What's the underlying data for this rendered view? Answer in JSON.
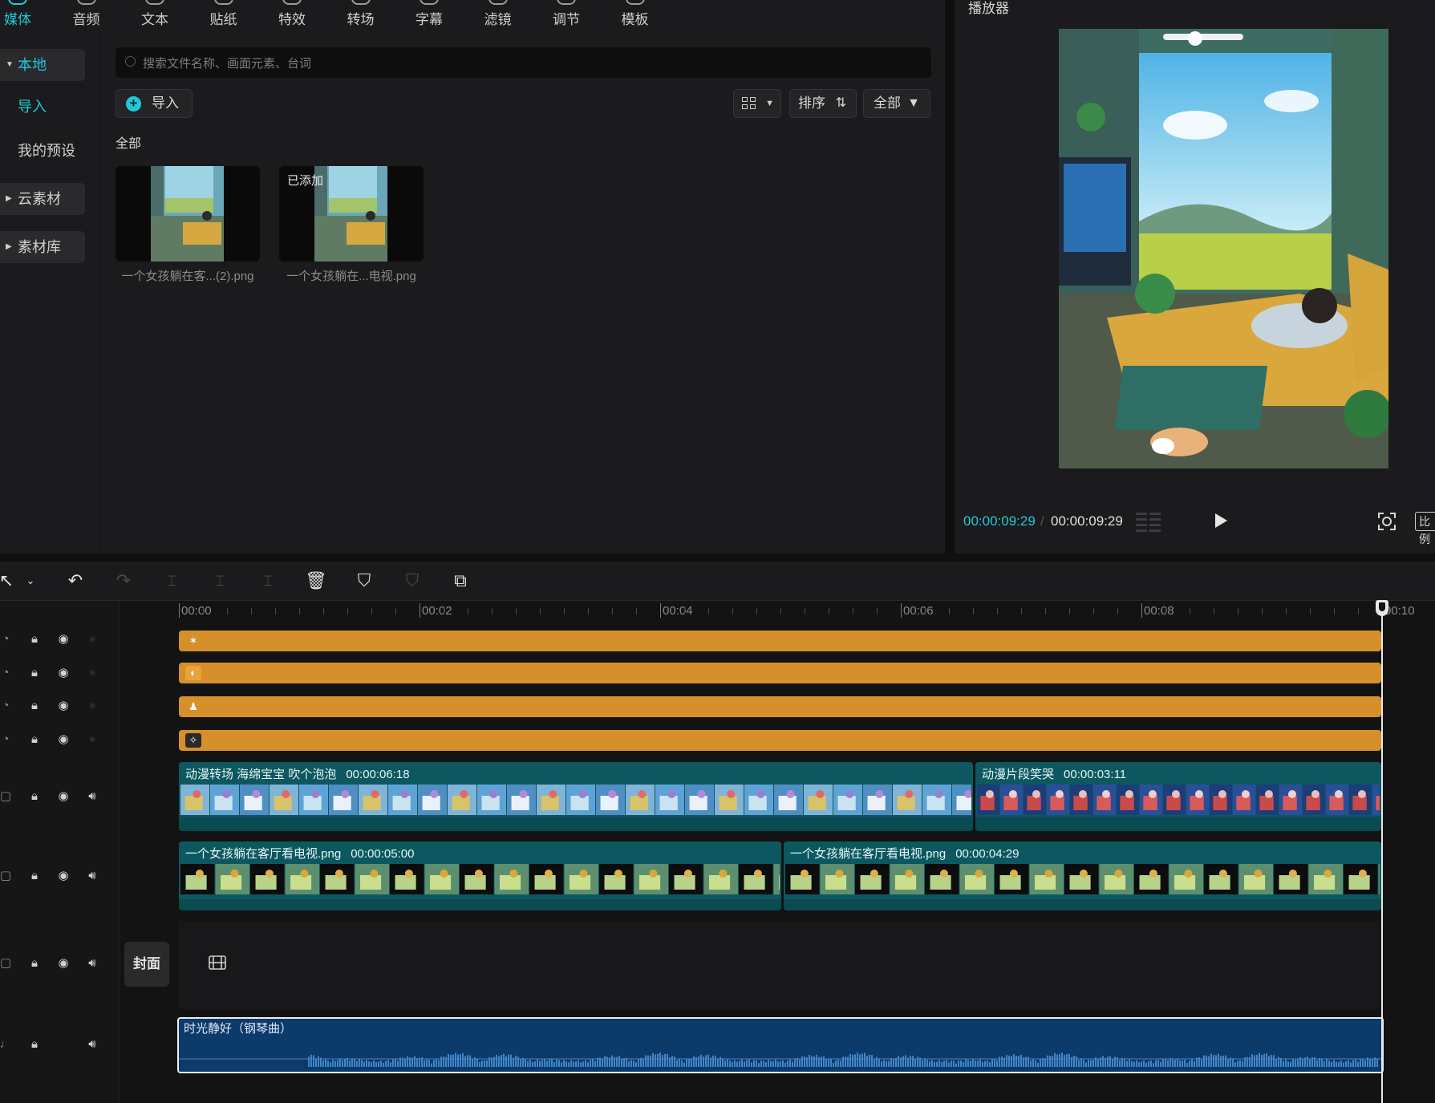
{
  "top_tabs": [
    {
      "label": "媒体",
      "active": true
    },
    {
      "label": "音频"
    },
    {
      "label": "文本"
    },
    {
      "label": "贴纸"
    },
    {
      "label": "特效"
    },
    {
      "label": "转场"
    },
    {
      "label": "字幕"
    },
    {
      "label": "滤镜"
    },
    {
      "label": "调节"
    },
    {
      "label": "模板"
    }
  ],
  "left_nav": {
    "local": "本地",
    "import": "导入",
    "my_presets": "我的预设",
    "cloud": "云素材",
    "library": "素材库"
  },
  "media": {
    "search_placeholder": "搜索文件名称、画面元素、台词",
    "import_label": "导入",
    "sort_label": "排序",
    "filter_label": "全部",
    "section_label": "全部",
    "items": [
      {
        "name": "一个女孩躺在客...(2).png",
        "badge": ""
      },
      {
        "name": "一个女孩躺在...电视.png",
        "badge": "已添加"
      }
    ]
  },
  "player": {
    "title": "播放器",
    "current_time": "00:00:09:29",
    "total_time": "00:00:09:29",
    "separator": "/",
    "ratio_label": "比例"
  },
  "timeline": {
    "ruler_labels": [
      "00:00",
      "00:02",
      "00:04",
      "00:06",
      "00:08",
      "00:10"
    ],
    "video_track_1": [
      {
        "title": "动漫转场 海绵宝宝 吹个泡泡",
        "duration": "00:00:06:18"
      },
      {
        "title": "动漫片段笑哭",
        "duration": "00:00:03:11"
      }
    ],
    "video_track_2": [
      {
        "title": "一个女孩躺在客厅看电视.png",
        "duration": "00:00:05:00"
      },
      {
        "title": "一个女孩躺在客厅看电视.png",
        "duration": "00:00:04:29"
      }
    ],
    "cover_label": "封面",
    "audio_track": {
      "title": "时光静好（钢琴曲）"
    }
  },
  "colors": {
    "accent": "#21c8d8",
    "sticker_track": "#d5902c",
    "video_clip": "#0d5860",
    "audio_clip": "#0b3a6b"
  }
}
